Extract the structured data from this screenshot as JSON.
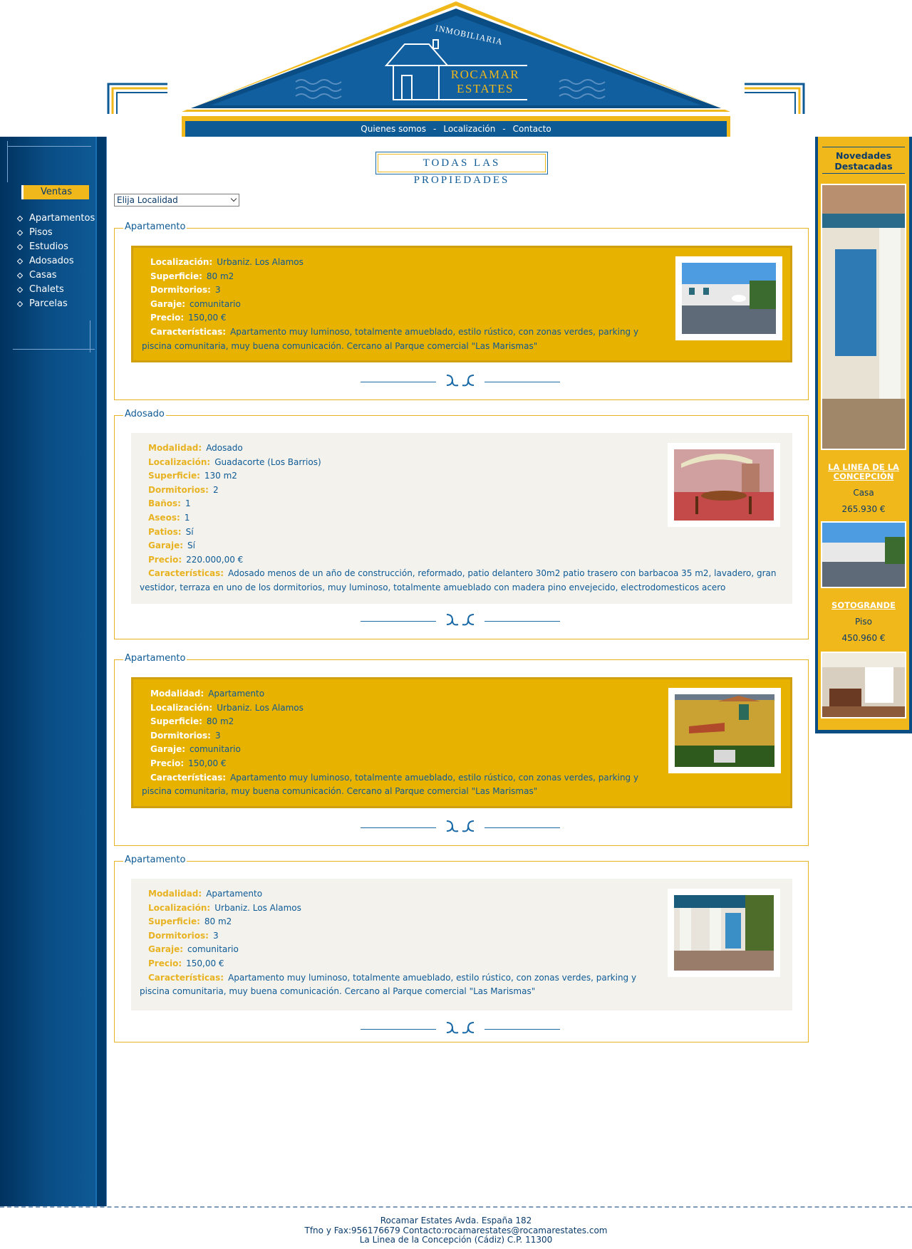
{
  "header": {
    "logo_arc": "INMOBILIARIA",
    "logo_line1": "ROCAMAR",
    "logo_line2": "ESTATES",
    "nav": [
      "Quienes somos",
      "Localización",
      "Contacto"
    ]
  },
  "sidebar": {
    "section_label": "Ventas",
    "items": [
      "Apartamentos",
      "Pisos",
      "Estudios",
      "Adosados",
      "Casas",
      "Chalets",
      "Parcelas"
    ]
  },
  "main": {
    "title": "TODAS LAS PROPIEDADES",
    "select_value": "Elija Localidad",
    "listings": [
      {
        "legend": "Apartamento",
        "style": "gold",
        "fields": [
          {
            "label": "Localización:",
            "value": "Urbaniz. Los Alamos"
          },
          {
            "label": "Superficie:",
            "value": "80 m2"
          },
          {
            "label": "Dormitorios:",
            "value": "3"
          },
          {
            "label": "Garaje:",
            "value": "comunitario"
          },
          {
            "label": "Precio:",
            "value": "150,00 €"
          }
        ],
        "desc_label": "Características:",
        "desc": "Apartamento muy luminoso, totalmente amueblado, estilo rústico, con zonas verdes, parking y piscina comunitaria, muy buena comunicación. Cercano al Parque comercial \"Las Marismas\""
      },
      {
        "legend": "Adosado",
        "style": "grey",
        "fields": [
          {
            "label": "Modalidad:",
            "value": "Adosado"
          },
          {
            "label": "Localización:",
            "value": "Guadacorte (Los Barrios)"
          },
          {
            "label": "Superficie:",
            "value": "130 m2"
          },
          {
            "label": "Dormitorios:",
            "value": "2"
          },
          {
            "label": "Baños:",
            "value": "1"
          },
          {
            "label": "Aseos:",
            "value": "1"
          },
          {
            "label": "Patios:",
            "value": "Sí"
          },
          {
            "label": "Garaje:",
            "value": "Sí"
          },
          {
            "label": "Precio:",
            "value": "220.000,00 €"
          }
        ],
        "desc_label": "Características:",
        "desc": "Adosado menos de un año de construcción, reformado, patio delantero 30m2 patio trasero con barbacoa 35 m2, lavadero, gran vestidor, terraza en uno de los dormitorios, muy luminoso, totalmente amueblado con madera pino envejecido, electrodomesticos acero"
      },
      {
        "legend": "Apartamento",
        "style": "gold",
        "fields": [
          {
            "label": "Modalidad:",
            "value": "Apartamento"
          },
          {
            "label": "Localización:",
            "value": "Urbaniz. Los Alamos"
          },
          {
            "label": "Superficie:",
            "value": "80 m2"
          },
          {
            "label": "Dormitorios:",
            "value": "3"
          },
          {
            "label": "Garaje:",
            "value": "comunitario"
          },
          {
            "label": "Precio:",
            "value": "150,00 €"
          }
        ],
        "desc_label": "Características:",
        "desc": "Apartamento muy luminoso, totalmente amueblado, estilo rústico, con zonas verdes, parking y piscina comunitaria, muy buena comunicación. Cercano al Parque comercial \"Las Marismas\""
      },
      {
        "legend": "Apartamento",
        "style": "grey",
        "fields": [
          {
            "label": "Modalidad:",
            "value": "Apartamento"
          },
          {
            "label": "Localización:",
            "value": "Urbaniz. Los Alamos"
          },
          {
            "label": "Superficie:",
            "value": "80 m2"
          },
          {
            "label": "Dormitorios:",
            "value": "3"
          },
          {
            "label": "Garaje:",
            "value": "comunitario"
          },
          {
            "label": "Precio:",
            "value": "150,00 €"
          }
        ],
        "desc_label": "Características:",
        "desc": "Apartamento muy luminoso, totalmente amueblado, estilo rústico, con zonas verdes, parking y piscina comunitaria, muy buena comunicación. Cercano al Parque comercial \"Las Marismas\""
      }
    ]
  },
  "featured": {
    "title": "Novedades Destacadas",
    "items": [
      {
        "name": "LA LINEA DE LA CONCEPCIÓN",
        "type": "Casa",
        "price": "265.930 €"
      },
      {
        "name": "SOTOGRANDE",
        "type": "Piso",
        "price": "450.960 €"
      }
    ]
  },
  "footer": {
    "line1": "Rocamar Estates Avda. España 182",
    "line2": "Tfno y Fax:956176679 Contacto:rocamarestates@rocamarestates.com",
    "line3": "La Linea de la Concepción (Cádiz) C.P. 11300"
  },
  "colors": {
    "brand_blue": "#0e5a95",
    "brand_gold": "#f1b81b",
    "dark_blue": "#00325f"
  }
}
